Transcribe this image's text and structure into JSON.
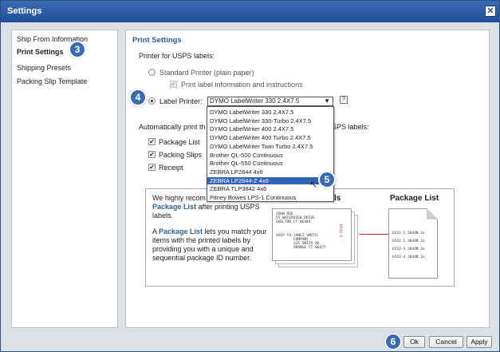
{
  "window": {
    "title": "Settings",
    "close_glyph": "✕"
  },
  "nav": {
    "items": [
      {
        "label": "Ship From Information"
      },
      {
        "label": "Print Settings"
      },
      {
        "label": "Shipping Presets"
      },
      {
        "label": "Packing Slip Template"
      }
    ]
  },
  "content": {
    "title": "Print Settings",
    "printer_label": "Printer for USPS labels:",
    "standard_printer": "Standard Printer (plain paper)",
    "print_label_info": "Print label information and instructions",
    "label_printer": "Label Printer:",
    "selected_printer": "DYMO LabelWriter 330 2.4X7.5",
    "help_glyph": "?",
    "auto_print_left": "Automatically print th",
    "auto_print_right": "SPS labels:",
    "options": [
      "DYMO LabelWriter 330 2.4X7.5",
      "DYMO LabelWriter 330-Turbo 2.4X7.5",
      "DYMO LabelWriter 400 2.4X7.5",
      "DYMO LabelWriter 400 Turbo 2.4X7.5",
      "DYMO LabelWriter Twin Turbo 2.4X7.5",
      "Brother QL-500 Continuous",
      "Brother QL-550 Continuous",
      "ZEBRA LP2844 4x6",
      "ZEBRA LP2844-Z 4x6",
      "ZEBRA TLP3842 4x6",
      "Pitney Bowes LPS-1 Continuous"
    ],
    "highlighted_index": 8,
    "checks": [
      {
        "label": "Package List"
      },
      {
        "label": "Packing Slips"
      },
      {
        "label": "Receipt"
      }
    ]
  },
  "info": {
    "line1": "We highly recom",
    "line1_link": "Package List",
    "line1b": " after printing USPS",
    "line1c": "labels.",
    "para2_a": "A ",
    "para2_link": "Package List",
    "para2_b": " lets you match your",
    "para2_c": "items with the printed labels by",
    "para2_d": "providing you with a unique and",
    "para2_e": "sequential package ID number.",
    "labels_heading": "ls",
    "package_list_heading": "Package List",
    "mini_label_top": "JOHN DOE\n55 WATERVIEW DRIVE\nSHELTON CT 06484",
    "mini_ship_to": "SHIP TO:",
    "mini_ship_addr": "JANEZ SMITH\nCOMPANY\n335 SMITH RD\nORANGE CT 06477",
    "mini_code": "b532-1",
    "list_lines": [
      "b532-1  2044N  2x",
      "b532-2  2044N  2x",
      "b532-3  2044N  2x",
      "b532-4  2044N  2x"
    ]
  },
  "badges": {
    "b3": "3",
    "b4": "4",
    "b5": "5",
    "b6": "6"
  },
  "buttons": {
    "ok": "Ok",
    "cancel": "Cancel",
    "apply": "Apply"
  }
}
